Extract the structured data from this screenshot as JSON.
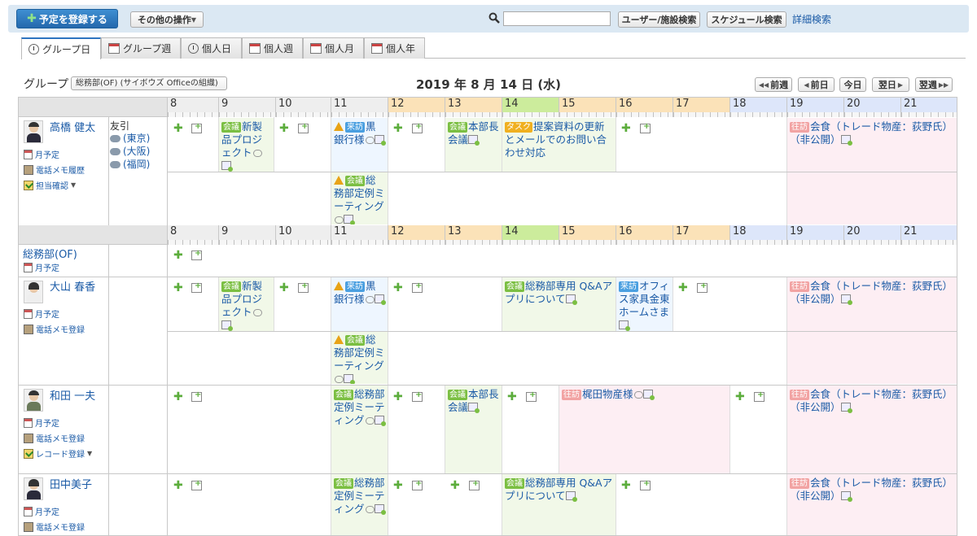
{
  "toolbar": {
    "register_label": "予定を登録する",
    "other_ops_label": "その他の操作",
    "search_input_value": "",
    "user_search_label": "ユーザー/施設検索",
    "schedule_search_label": "スケジュール検索",
    "advanced_search_label": "詳細検索"
  },
  "tabs": [
    "グループ日",
    "グループ週",
    "個人日",
    "個人週",
    "個人月",
    "個人年"
  ],
  "group": {
    "label": "グループ",
    "selected": "総務部(OF) (サイボウズ Officeの組織)",
    "date": "2019 年 8 月 14 日 (水)"
  },
  "nav": {
    "prev_week": "前週",
    "prev_day": "前日",
    "today": "今日",
    "next_day": "翌日",
    "next_week": "翌週"
  },
  "hours": [
    "8",
    "9",
    "10",
    "11",
    "12",
    "13",
    "14",
    "15",
    "16",
    "17",
    "18",
    "19",
    "20",
    "21"
  ],
  "common": {
    "monthly_label": "月予定",
    "phone_history_label": "電話メモ履歴",
    "phone_register_label": "電話メモ登録",
    "assignee_confirm_label": "担当確認",
    "record_register_label": "レコード登録"
  },
  "badges": {
    "meeting": "会議",
    "visit": "来訪",
    "task": "タスク",
    "out": "往訪"
  },
  "users": [
    {
      "name": "高橋 健太"
    },
    {
      "name": "大山 春香"
    },
    {
      "name": "和田 一夫"
    },
    {
      "name": "田中美子"
    }
  ],
  "weather": {
    "title": "友引",
    "items": [
      "(東京)",
      "(大阪)",
      "(福岡)"
    ]
  },
  "group_row": {
    "name": "総務部(OF)"
  },
  "events": {
    "new_product": "新製品プロジェクト",
    "kurome_bank": "黒銀行様",
    "honbu_meeting": "本部長会議",
    "proposal_task": "提案資料の更新とメールでのお問い合わせ対応",
    "dinner": "会食（トレード物産：荻野氏）（非公開）",
    "regular_meeting": "総務部定例ミーティング",
    "qa_meeting": "総務部専用 Q&Aアプリについて",
    "office_furniture": "オフィス家具金東ホームさま",
    "kajita": "梶田物産様"
  }
}
